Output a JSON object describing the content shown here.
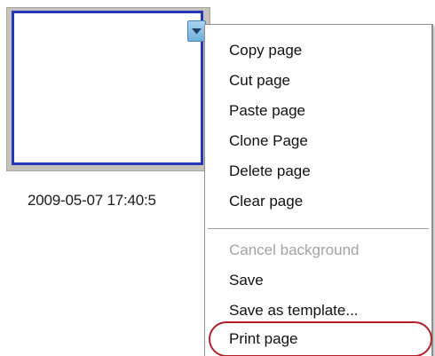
{
  "thumbnail": {
    "timestamp": "2009-05-07 17:40:5",
    "frame_color": "#2438b8",
    "dropdown_icon": "chevron-down-icon"
  },
  "context_menu": {
    "items": [
      {
        "label": "Copy page",
        "enabled": true
      },
      {
        "label": "Cut page",
        "enabled": true
      },
      {
        "label": "Paste page",
        "enabled": true
      },
      {
        "label": "Clone Page",
        "enabled": true
      },
      {
        "label": "Delete page",
        "enabled": true
      },
      {
        "label": "Clear page",
        "enabled": true
      },
      {
        "label": "Cancel background",
        "enabled": false
      },
      {
        "label": "Save",
        "enabled": true
      },
      {
        "label": "Save as template...",
        "enabled": true
      },
      {
        "label": "Print page",
        "enabled": true,
        "highlighted": true
      }
    ],
    "highlight_color": "#b3202a"
  }
}
